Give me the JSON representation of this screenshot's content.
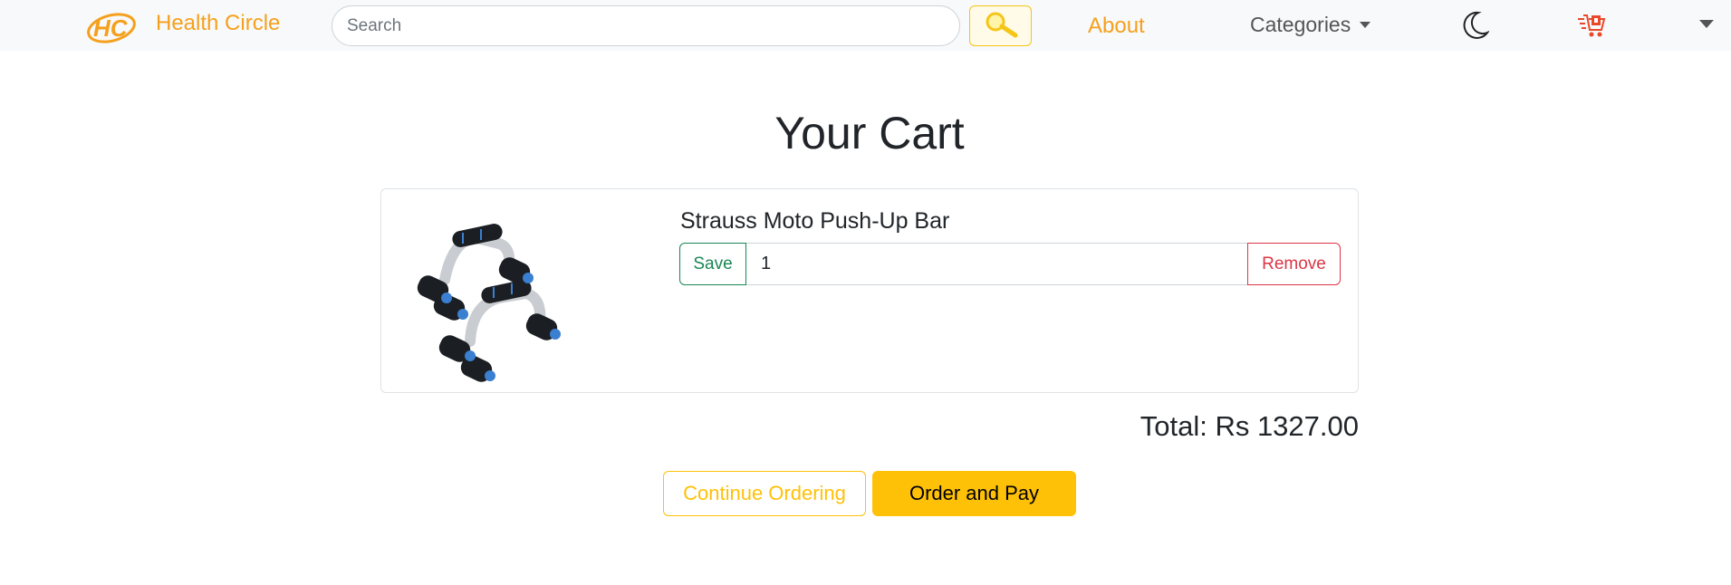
{
  "navbar": {
    "brand_name": "Health Circle",
    "logo_text": "HC",
    "search_placeholder": "Search",
    "search_icon": "search-icon",
    "about_label": "About",
    "categories_label": "Categories",
    "theme_icon": "moon-icon",
    "cart_icon": "cart-icon",
    "user_menu_icon": "chevron-down-icon"
  },
  "page": {
    "title": "Your Cart"
  },
  "cart": {
    "items": [
      {
        "name": "Strauss Moto Push-Up Bar",
        "quantity": "1",
        "save_label": "Save",
        "remove_label": "Remove",
        "image_icon": "push-up-bar-image"
      }
    ],
    "total": "Total: Rs 1327.00"
  },
  "actions": {
    "continue_label": "Continue Ordering",
    "order_label": "Order and Pay"
  },
  "colors": {
    "brand": "#f5a01d",
    "accent": "#ffc107",
    "save": "#198754",
    "remove": "#dc3545"
  }
}
